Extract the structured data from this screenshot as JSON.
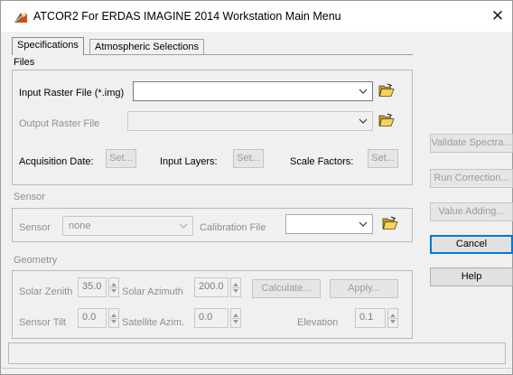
{
  "window": {
    "title": "ATCOR2 For ERDAS IMAGINE 2014   Workstation Main Menu",
    "close_glyph": "✕"
  },
  "tabs": [
    {
      "label": "Specifications",
      "active": true
    },
    {
      "label": "Atmospheric Selections",
      "active": false
    }
  ],
  "files": {
    "section_label": "Files",
    "input_raster_label": "Input Raster File (*.img)",
    "input_raster_value": "",
    "output_raster_label": "Output Raster File",
    "output_raster_value": "",
    "acquisition_date_label": "Acquisition Date:",
    "acquisition_date_button": "Set...",
    "input_layers_label": "Input Layers:",
    "input_layers_button": "Set...",
    "scale_factors_label": "Scale Factors:",
    "scale_factors_button": "Set..."
  },
  "sensor": {
    "section_label": "Sensor",
    "sensor_label": "Sensor",
    "sensor_value": "none",
    "calibration_label": "Calibration File",
    "calibration_value": ""
  },
  "geometry": {
    "section_label": "Geometry",
    "solar_zenith_label": "Solar Zenith",
    "solar_zenith_value": "35.0",
    "solar_azimuth_label": "Solar Azimuth",
    "solar_azimuth_value": "200.0",
    "calculate_button": "Calculate...",
    "apply_button": "Apply...",
    "sensor_tilt_label": "Sensor Tilt",
    "sensor_tilt_value": "0.0",
    "satellite_azim_label": "Satellite Azim.",
    "satellite_azim_value": "0.0",
    "elevation_label": "Elevation",
    "elevation_value": "0.1"
  },
  "side_buttons": {
    "validate_spectra": "Validate Spectra...",
    "run_correction": "Run Correction...",
    "value_adding": "Value Adding...",
    "cancel": "Cancel",
    "help": "Help"
  },
  "icons": {
    "app": "atcor-app-icon",
    "folder": "open-folder-icon",
    "dropdown": "chevron-down-icon",
    "spinner": "spin-up-down-icon"
  },
  "colors": {
    "window_bg": "#f0f0f0",
    "focus_blue": "#0078d7",
    "disabled_text": "#8e8e8e",
    "folder_yellow": "#e8c44a"
  }
}
